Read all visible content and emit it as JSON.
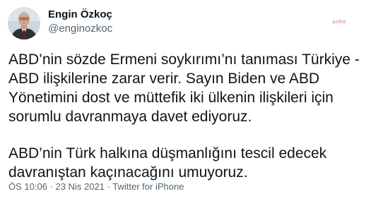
{
  "tweet": {
    "author_name": "Engin Özkoç",
    "author_handle": "@enginozkoc",
    "watermark": "anka",
    "paragraphs": [
      "ABD’nin sözde Ermeni soykırımı’nı tanıması Türkiye - ABD ilişkilerine zarar verir. Sayın Biden ve ABD Yönetimini dost ve müttefik iki ülkenin ilişkileri için sorumlu davranmaya davet ediyoruz.",
      "ABD’nin Türk halkına düşmanlığını tescil edecek davranıştan kaçınacağını umuyoruz."
    ],
    "time": "ÖS 10:06",
    "separator1": "·",
    "date": "23 Nis 2021",
    "separator2": "·",
    "source": "Twitter for iPhone"
  }
}
